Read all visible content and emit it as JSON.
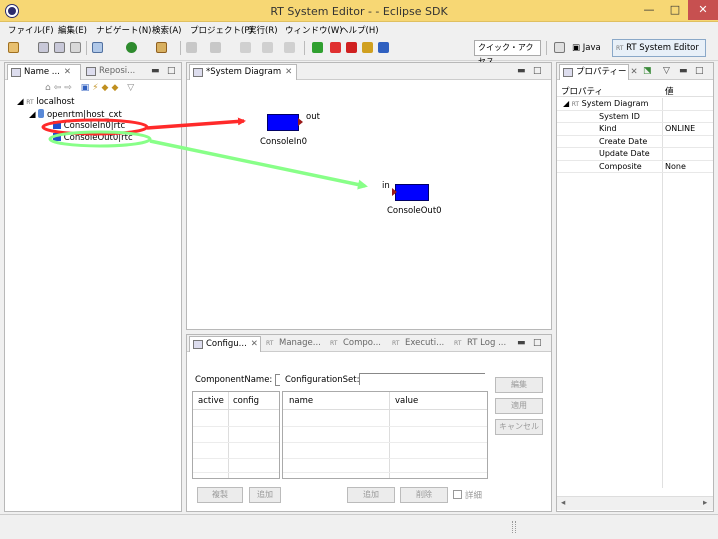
{
  "window": {
    "title": "RT System Editor -  - Eclipse SDK",
    "min_glyph": "—",
    "max_glyph": "□",
    "close_glyph": "✕"
  },
  "menu": [
    "ファイル(F)",
    "編集(E)",
    "ナビゲート(N)",
    "検索(A)",
    "プロジェクト(P)",
    "実行(R)",
    "ウィンドウ(W)",
    "ヘルプ(H)"
  ],
  "toolbar": {
    "quick_access": "クイック・アクセス",
    "perspectives": {
      "java": "Java",
      "rt": "RT System Editor",
      "rt_icon": "RT"
    }
  },
  "name_service_view": {
    "tabs": [
      "Name ...",
      "Reposi..."
    ],
    "tree": {
      "root": "localhost",
      "root_icon": "RT",
      "context": "openrtm|host_cxt",
      "components": [
        "ConsoleIn0|rtc",
        "ConsoleOut0|rtc"
      ]
    }
  },
  "system_diagram": {
    "tab": "*System Diagram",
    "components": [
      {
        "name": "ConsoleIn0",
        "port": "out"
      },
      {
        "name": "ConsoleOut0",
        "port": "in"
      }
    ]
  },
  "bottom_tabs": [
    "Configu...",
    "Manage...",
    "Compo...",
    "Executi...",
    "RT Log ..."
  ],
  "configuration_view": {
    "component_name_label": "ComponentName:",
    "configuration_set_label": "ConfigurationSet:",
    "set_columns": [
      "active",
      "config"
    ],
    "param_columns": [
      "name",
      "value"
    ],
    "buttons": {
      "edit": "編集",
      "apply": "適用",
      "cancel": "キャンセル",
      "copy": "複製",
      "add_set": "追加",
      "add_param": "追加",
      "delete_param": "削除",
      "detail": "詳細"
    }
  },
  "properties_view": {
    "tab": "プロパティー",
    "col_property": "プロパティ",
    "col_value": "値",
    "root": "System Diagram",
    "rows": [
      {
        "key": "System ID",
        "value": ""
      },
      {
        "key": "Kind",
        "value": "ONLINE"
      },
      {
        "key": "Create Date",
        "value": ""
      },
      {
        "key": "Update Date",
        "value": ""
      },
      {
        "key": "Composite",
        "value": "None"
      }
    ]
  },
  "colors": {
    "title_bar": "#f7d774",
    "component": "#0000ff",
    "red_arrow": "#ff2a2a",
    "green_arrow": "#88ff88"
  }
}
